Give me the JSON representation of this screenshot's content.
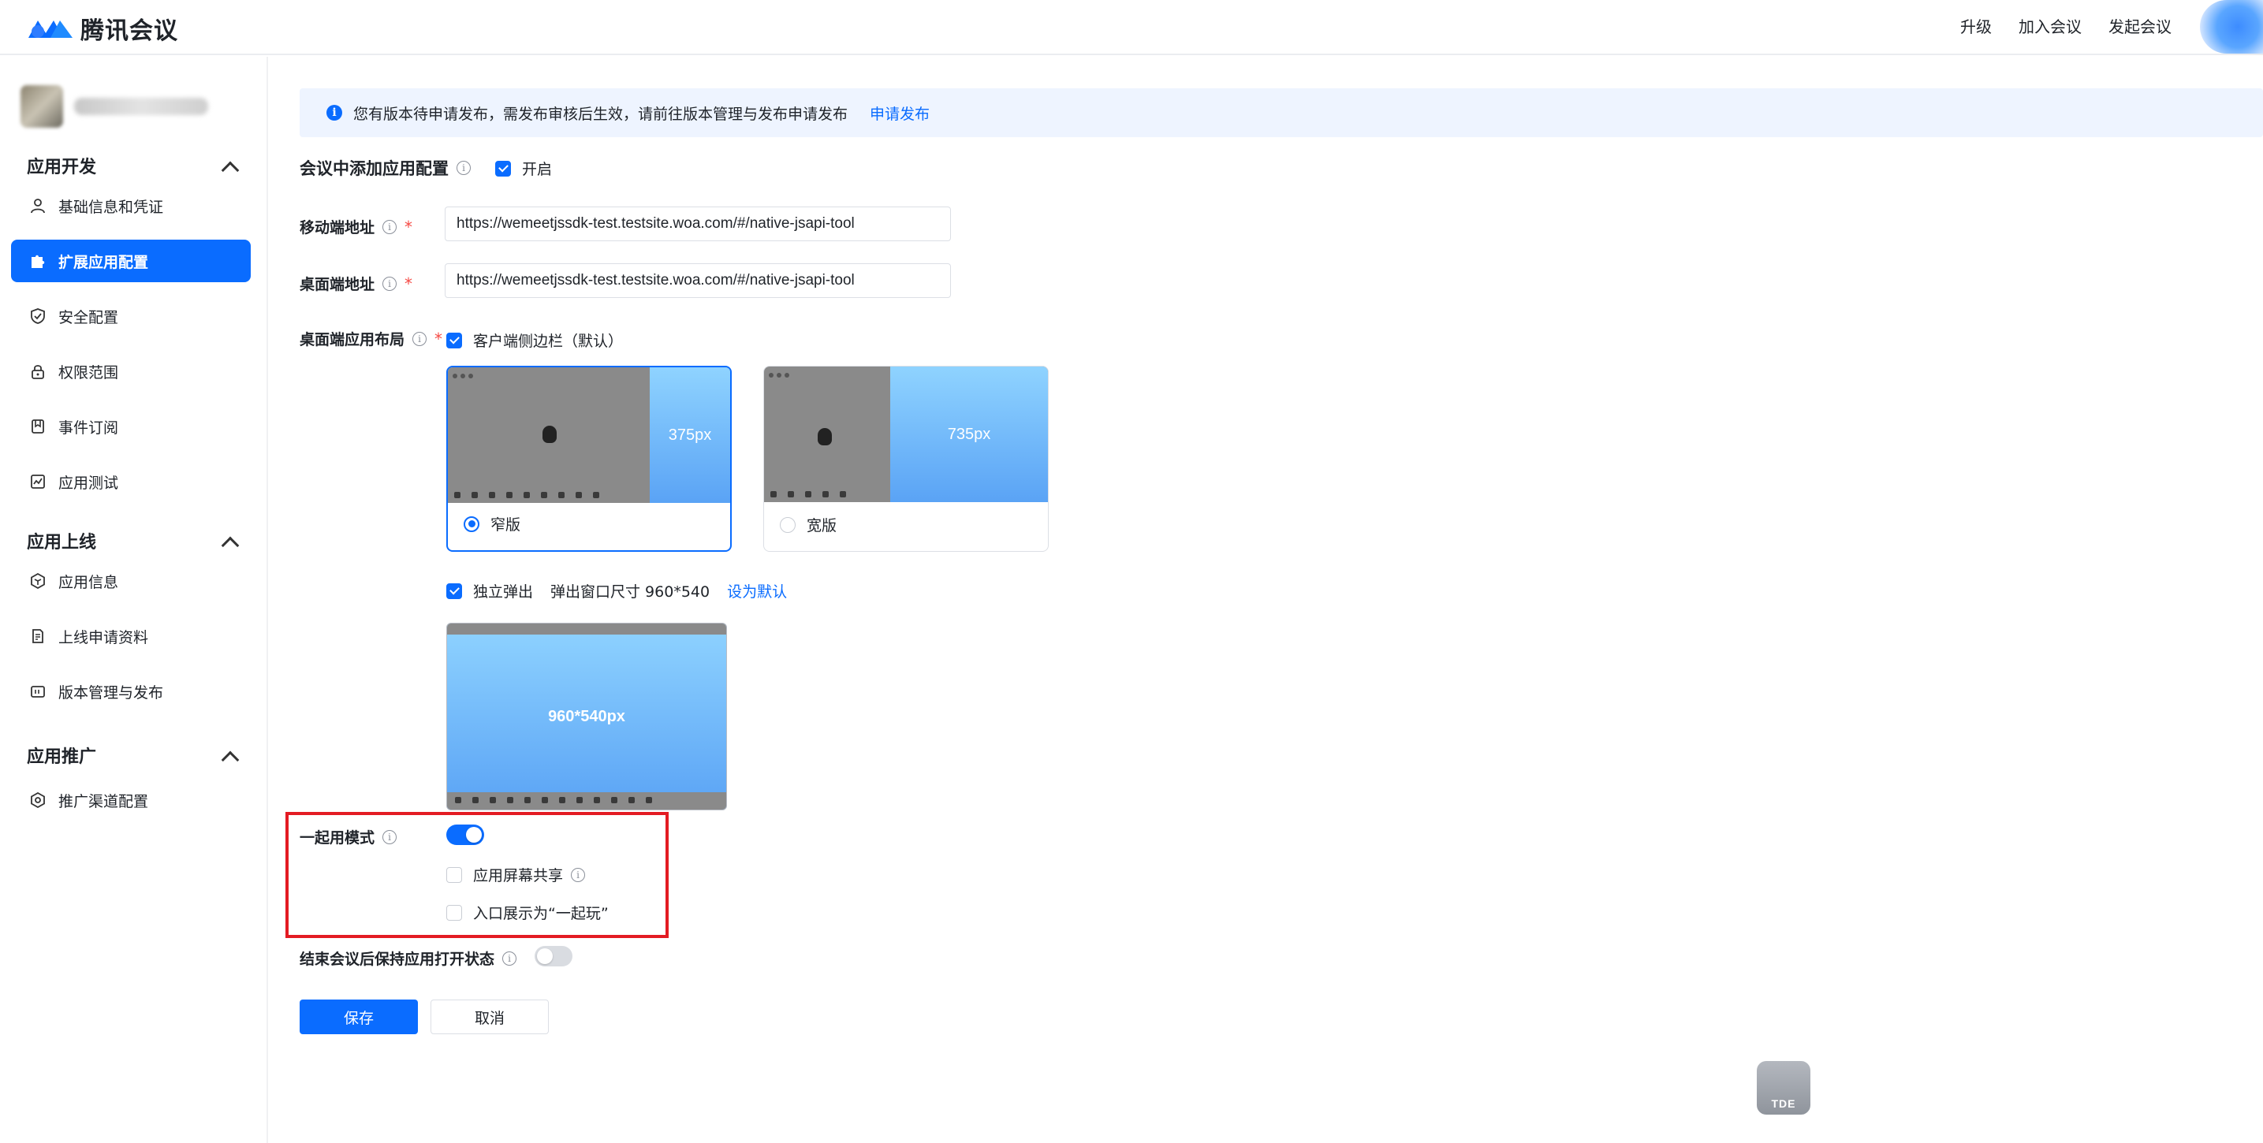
{
  "header": {
    "brand": "腾讯会议",
    "nav": [
      "升级",
      "加入会议",
      "发起会议"
    ]
  },
  "sidebar": {
    "groups": [
      {
        "title": "应用开发",
        "items": [
          {
            "label": "基础信息和凭证",
            "icon": "user-icon"
          },
          {
            "label": "扩展应用配置",
            "icon": "puzzle-icon",
            "active": true
          },
          {
            "label": "安全配置",
            "icon": "shield-icon"
          },
          {
            "label": "权限范围",
            "icon": "lock-icon"
          },
          {
            "label": "事件订阅",
            "icon": "bookmark-icon"
          },
          {
            "label": "应用测试",
            "icon": "chart-icon"
          }
        ]
      },
      {
        "title": "应用上线",
        "items": [
          {
            "label": "应用信息",
            "icon": "hexagon-icon"
          },
          {
            "label": "上线申请资料",
            "icon": "document-icon"
          },
          {
            "label": "版本管理与发布",
            "icon": "version-icon"
          }
        ]
      },
      {
        "title": "应用推广",
        "items": [
          {
            "label": "推广渠道配置",
            "icon": "gear-icon"
          }
        ]
      }
    ]
  },
  "notice": {
    "text": "您有版本待申请发布，需发布审核后生效，请前往版本管理与发布申请发布",
    "link": "申请发布"
  },
  "form": {
    "addAppConfig": {
      "label": "会议中添加应用配置",
      "checkbox_label": "开启",
      "checked": true
    },
    "mobileUrl": {
      "label": "移动端地址",
      "value": "https://wemeetjssdk-test.testsite.woa.com/#/native-jsapi-tool"
    },
    "desktopUrl": {
      "label": "桌面端地址",
      "value": "https://wemeetjssdk-test.testsite.woa.com/#/native-jsapi-tool"
    },
    "desktopLayout": {
      "label": "桌面端应用布局",
      "sidebar_option": "客户端侧边栏（默认）",
      "narrow": {
        "size": "375px",
        "label": "窄版",
        "selected": true
      },
      "wide": {
        "size": "735px",
        "label": "宽版",
        "selected": false
      },
      "popup_option": "独立弹出",
      "popup_size_text": "弹出窗口尺寸 960*540",
      "set_default": "设为默认",
      "popup_preview": "960*540px"
    },
    "togetherMode": {
      "label": "一起用模式",
      "enabled": true,
      "screen_share": "应用屏幕共享",
      "entry_play": "入口展示为“一起玩”"
    },
    "keepOpen": {
      "label": "结束会议后保持应用打开状态",
      "enabled": false
    },
    "save": "保存",
    "cancel": "取消"
  },
  "badge": {
    "text": "TDE"
  },
  "colors": {
    "accent": "#0a6cff",
    "highlight": "#e31b23",
    "notice_bg": "#eef4ff"
  }
}
